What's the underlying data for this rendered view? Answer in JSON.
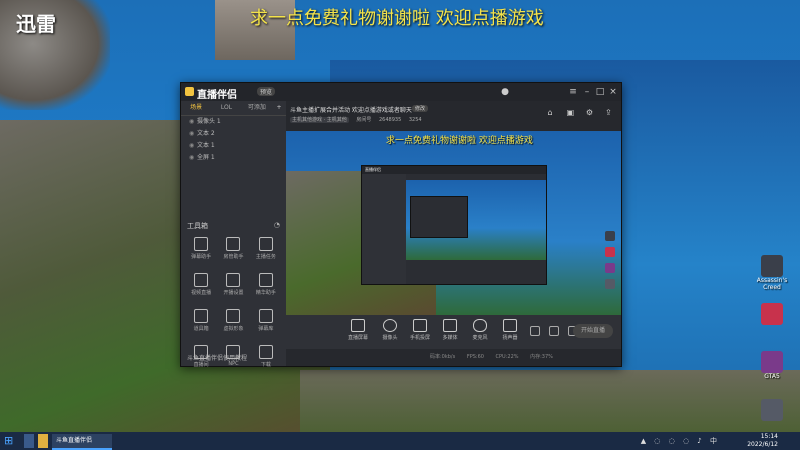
{
  "desktop": {
    "overlay_title": "求一点免费礼物谢谢啦 欢迎点播游戏",
    "logo_text": "迅雷",
    "icons": [
      {
        "label": "Assassin's Creed",
        "color": "#3a3f4a"
      },
      {
        "label": "",
        "color": "#c8324c"
      },
      {
        "label": "GTA5",
        "color": "#7a3a8a"
      },
      {
        "label": "",
        "color": "#555a66"
      }
    ]
  },
  "window": {
    "app_name": "直播伴侣",
    "version_badge": "预览",
    "controls": [
      "avatar",
      "menu",
      "minimize",
      "maximize",
      "close"
    ]
  },
  "sidebar": {
    "tabs": [
      {
        "label": "场景",
        "active": true
      },
      {
        "label": "LOL",
        "active": false
      },
      {
        "label": "可添加",
        "active": false
      }
    ],
    "scenes": [
      {
        "label": "摄像头 1"
      },
      {
        "label": "文本 2"
      },
      {
        "label": "文本 1"
      },
      {
        "label": "全屏 1"
      }
    ],
    "tools_title": "工具箱",
    "tools": [
      {
        "label": "弹幕助手"
      },
      {
        "label": "房管助手"
      },
      {
        "label": "主播任务"
      },
      {
        "label": "视频直播"
      },
      {
        "label": "开播设置"
      },
      {
        "label": "精华助手"
      },
      {
        "label": "道具箱"
      },
      {
        "label": "虚拟形象"
      },
      {
        "label": "弹幕库"
      },
      {
        "label": "直播间"
      },
      {
        "label": "NPC"
      },
      {
        "label": "下载"
      }
    ],
    "status_link": "斗鱼直播伴侣使用教程"
  },
  "main": {
    "room_title": "斗鱼主播扩展合并活动 欢迎点播游戏或者聊天",
    "edit_label": "修改",
    "meta": {
      "category": "主机其他游戏 · 主机其他",
      "room_label": "房间号",
      "room_id": "2648935",
      "hot_value": "3254"
    },
    "preview_title": "求一点免费礼物谢谢啦 欢迎点播游戏",
    "controls": [
      {
        "label": "直播屏幕",
        "icon": "screen-icon"
      },
      {
        "label": "摄像头",
        "icon": "camera-icon"
      },
      {
        "label": "手机投屏",
        "icon": "phone-icon"
      },
      {
        "label": "多媒体",
        "icon": "media-icon"
      },
      {
        "label": "麦克风",
        "icon": "mic-icon"
      },
      {
        "label": "扬声器",
        "icon": "speaker-icon"
      }
    ],
    "start_live": "开始直播",
    "status": [
      "码率:0kb/s",
      "FPS:60",
      "CPU:22%",
      "内存:37%"
    ]
  },
  "taskbar": {
    "app_label": "斗鱼直播伴侣",
    "time": "15:14",
    "date": "2022/6/12"
  }
}
